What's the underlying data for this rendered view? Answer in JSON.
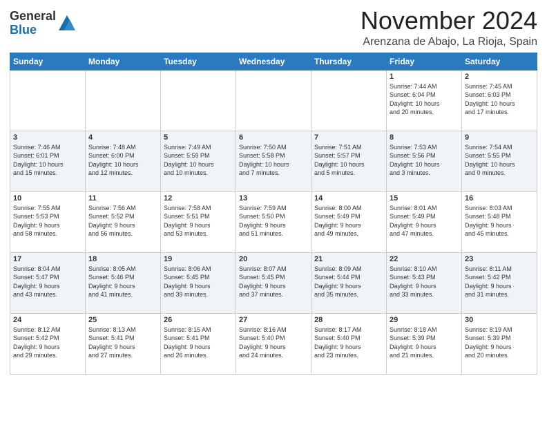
{
  "logo": {
    "general": "General",
    "blue": "Blue"
  },
  "header": {
    "month": "November 2024",
    "location": "Arenzana de Abajo, La Rioja, Spain"
  },
  "weekdays": [
    "Sunday",
    "Monday",
    "Tuesday",
    "Wednesday",
    "Thursday",
    "Friday",
    "Saturday"
  ],
  "weeks": [
    [
      {
        "day": "",
        "info": ""
      },
      {
        "day": "",
        "info": ""
      },
      {
        "day": "",
        "info": ""
      },
      {
        "day": "",
        "info": ""
      },
      {
        "day": "",
        "info": ""
      },
      {
        "day": "1",
        "info": "Sunrise: 7:44 AM\nSunset: 6:04 PM\nDaylight: 10 hours\nand 20 minutes."
      },
      {
        "day": "2",
        "info": "Sunrise: 7:45 AM\nSunset: 6:03 PM\nDaylight: 10 hours\nand 17 minutes."
      }
    ],
    [
      {
        "day": "3",
        "info": "Sunrise: 7:46 AM\nSunset: 6:01 PM\nDaylight: 10 hours\nand 15 minutes."
      },
      {
        "day": "4",
        "info": "Sunrise: 7:48 AM\nSunset: 6:00 PM\nDaylight: 10 hours\nand 12 minutes."
      },
      {
        "day": "5",
        "info": "Sunrise: 7:49 AM\nSunset: 5:59 PM\nDaylight: 10 hours\nand 10 minutes."
      },
      {
        "day": "6",
        "info": "Sunrise: 7:50 AM\nSunset: 5:58 PM\nDaylight: 10 hours\nand 7 minutes."
      },
      {
        "day": "7",
        "info": "Sunrise: 7:51 AM\nSunset: 5:57 PM\nDaylight: 10 hours\nand 5 minutes."
      },
      {
        "day": "8",
        "info": "Sunrise: 7:53 AM\nSunset: 5:56 PM\nDaylight: 10 hours\nand 3 minutes."
      },
      {
        "day": "9",
        "info": "Sunrise: 7:54 AM\nSunset: 5:55 PM\nDaylight: 10 hours\nand 0 minutes."
      }
    ],
    [
      {
        "day": "10",
        "info": "Sunrise: 7:55 AM\nSunset: 5:53 PM\nDaylight: 9 hours\nand 58 minutes."
      },
      {
        "day": "11",
        "info": "Sunrise: 7:56 AM\nSunset: 5:52 PM\nDaylight: 9 hours\nand 56 minutes."
      },
      {
        "day": "12",
        "info": "Sunrise: 7:58 AM\nSunset: 5:51 PM\nDaylight: 9 hours\nand 53 minutes."
      },
      {
        "day": "13",
        "info": "Sunrise: 7:59 AM\nSunset: 5:50 PM\nDaylight: 9 hours\nand 51 minutes."
      },
      {
        "day": "14",
        "info": "Sunrise: 8:00 AM\nSunset: 5:49 PM\nDaylight: 9 hours\nand 49 minutes."
      },
      {
        "day": "15",
        "info": "Sunrise: 8:01 AM\nSunset: 5:49 PM\nDaylight: 9 hours\nand 47 minutes."
      },
      {
        "day": "16",
        "info": "Sunrise: 8:03 AM\nSunset: 5:48 PM\nDaylight: 9 hours\nand 45 minutes."
      }
    ],
    [
      {
        "day": "17",
        "info": "Sunrise: 8:04 AM\nSunset: 5:47 PM\nDaylight: 9 hours\nand 43 minutes."
      },
      {
        "day": "18",
        "info": "Sunrise: 8:05 AM\nSunset: 5:46 PM\nDaylight: 9 hours\nand 41 minutes."
      },
      {
        "day": "19",
        "info": "Sunrise: 8:06 AM\nSunset: 5:45 PM\nDaylight: 9 hours\nand 39 minutes."
      },
      {
        "day": "20",
        "info": "Sunrise: 8:07 AM\nSunset: 5:45 PM\nDaylight: 9 hours\nand 37 minutes."
      },
      {
        "day": "21",
        "info": "Sunrise: 8:09 AM\nSunset: 5:44 PM\nDaylight: 9 hours\nand 35 minutes."
      },
      {
        "day": "22",
        "info": "Sunrise: 8:10 AM\nSunset: 5:43 PM\nDaylight: 9 hours\nand 33 minutes."
      },
      {
        "day": "23",
        "info": "Sunrise: 8:11 AM\nSunset: 5:42 PM\nDaylight: 9 hours\nand 31 minutes."
      }
    ],
    [
      {
        "day": "24",
        "info": "Sunrise: 8:12 AM\nSunset: 5:42 PM\nDaylight: 9 hours\nand 29 minutes."
      },
      {
        "day": "25",
        "info": "Sunrise: 8:13 AM\nSunset: 5:41 PM\nDaylight: 9 hours\nand 27 minutes."
      },
      {
        "day": "26",
        "info": "Sunrise: 8:15 AM\nSunset: 5:41 PM\nDaylight: 9 hours\nand 26 minutes."
      },
      {
        "day": "27",
        "info": "Sunrise: 8:16 AM\nSunset: 5:40 PM\nDaylight: 9 hours\nand 24 minutes."
      },
      {
        "day": "28",
        "info": "Sunrise: 8:17 AM\nSunset: 5:40 PM\nDaylight: 9 hours\nand 23 minutes."
      },
      {
        "day": "29",
        "info": "Sunrise: 8:18 AM\nSunset: 5:39 PM\nDaylight: 9 hours\nand 21 minutes."
      },
      {
        "day": "30",
        "info": "Sunrise: 8:19 AM\nSunset: 5:39 PM\nDaylight: 9 hours\nand 20 minutes."
      }
    ]
  ]
}
